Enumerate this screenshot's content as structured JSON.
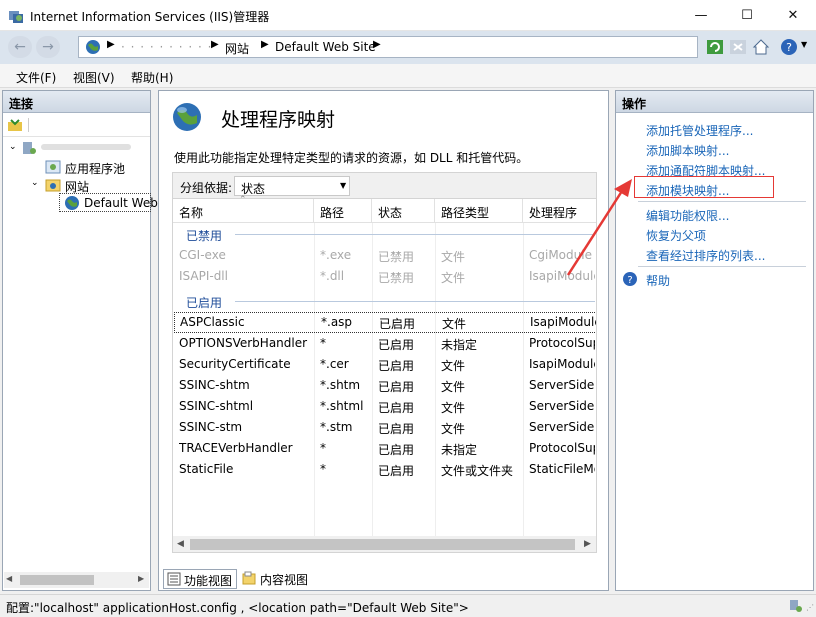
{
  "window": {
    "title": "Internet Information Services (IIS)管理器",
    "minimize": "—",
    "maximize": "☐",
    "close": "✕"
  },
  "address": {
    "crumbs": [
      "网站",
      "Default Web Site"
    ],
    "host_masked": "· · · · · · · · · ·"
  },
  "menu": [
    "文件(F)",
    "视图(V)",
    "帮助(H)"
  ],
  "connections": {
    "title": "连接",
    "tree": {
      "apppools": "应用程序池",
      "sites": "网站",
      "defaultweb": "Default Web"
    }
  },
  "main": {
    "title": "处理程序映射",
    "description": "使用此功能指定处理特定类型的请求的资源，如 DLL 和托管代码。",
    "groupby_label": "分组依据:",
    "groupby_value": "状态",
    "columns": [
      "名称",
      "路径",
      "状态",
      "路径类型",
      "处理程序"
    ],
    "groups": [
      {
        "name": "已禁用",
        "rows": [
          [
            "CGI-exe",
            "*.exe",
            "已禁用",
            "文件",
            "CgiModule"
          ],
          [
            "ISAPI-dll",
            "*.dll",
            "已禁用",
            "文件",
            "IsapiModule"
          ]
        ]
      },
      {
        "name": "已启用",
        "rows": [
          [
            "ASPClassic",
            "*.asp",
            "已启用",
            "文件",
            "IsapiModule"
          ],
          [
            "OPTIONSVerbHandler",
            "*",
            "已启用",
            "未指定",
            "ProtocolSupp"
          ],
          [
            "SecurityCertificate",
            "*.cer",
            "已启用",
            "文件",
            "IsapiModule"
          ],
          [
            "SSINC-shtm",
            "*.shtm",
            "已启用",
            "文件",
            "ServerSideInc"
          ],
          [
            "SSINC-shtml",
            "*.shtml",
            "已启用",
            "文件",
            "ServerSideInc"
          ],
          [
            "SSINC-stm",
            "*.stm",
            "已启用",
            "文件",
            "ServerSideInc"
          ],
          [
            "TRACEVerbHandler",
            "*",
            "已启用",
            "未指定",
            "ProtocolSupp"
          ],
          [
            "StaticFile",
            "*",
            "已启用",
            "文件或文件夹",
            "StaticFileMod"
          ]
        ]
      }
    ]
  },
  "views": {
    "features": "功能视图",
    "content": "内容视图"
  },
  "actions": {
    "title": "操作",
    "links": [
      "添加托管处理程序...",
      "添加脚本映射...",
      "添加通配符脚本映射...",
      "添加模块映射...",
      "编辑功能权限...",
      "恢复为父项",
      "查看经过排序的列表..."
    ],
    "help": "帮助"
  },
  "status": "配置:\"localhost\" applicationHost.config , <location path=\"Default Web Site\">",
  "colors": {
    "accent": "#1a66b8",
    "highlight_box": "#e53935",
    "arrow": "#e53935"
  }
}
